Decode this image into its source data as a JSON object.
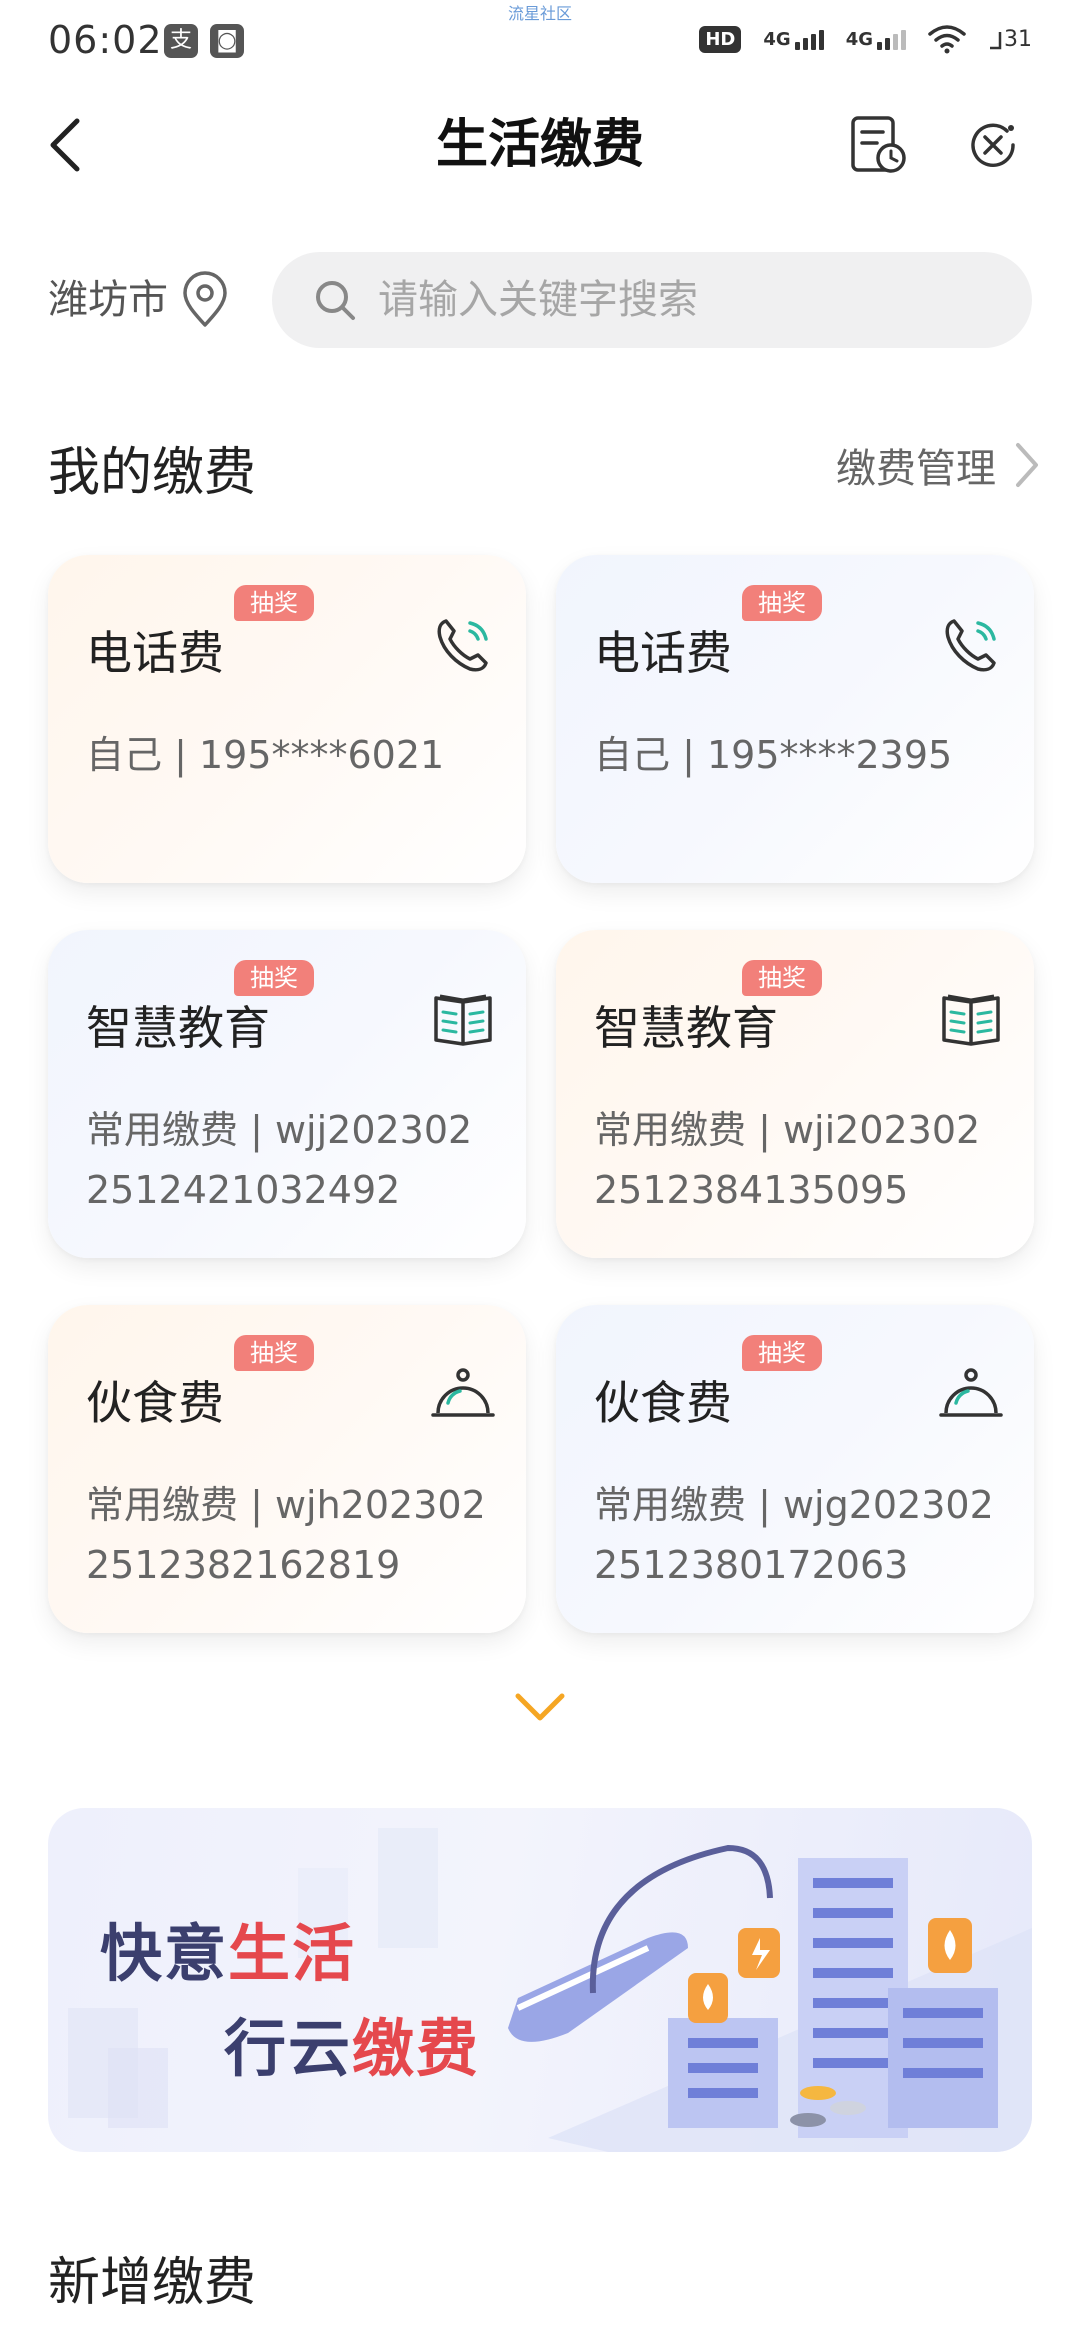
{
  "status_bar": {
    "time": "06:02",
    "app_icons": [
      "支",
      "◙"
    ],
    "watermark": "流星社区",
    "hd_label": "HD",
    "network1": "4G",
    "network2": "4G",
    "battery": "31"
  },
  "header": {
    "title": "生活缴费",
    "back_icon": "chevron-left-icon",
    "record_icon": "bill-record-icon",
    "close_icon": "close-icon"
  },
  "location": {
    "city": "潍坊市"
  },
  "search": {
    "placeholder": "请输入关键字搜索"
  },
  "my_payments": {
    "title": "我的缴费",
    "manage_label": "缴费管理",
    "cards": [
      {
        "badge": "抽奖",
        "title": "电话费",
        "subtitle": "自己 | 195****6021",
        "icon": "phone-icon",
        "theme": "warm"
      },
      {
        "badge": "抽奖",
        "title": "电话费",
        "subtitle": "自己 | 195****2395",
        "icon": "phone-icon",
        "theme": "cool"
      },
      {
        "badge": "抽奖",
        "title": "智慧教育",
        "subtitle": "常用缴费 | wjj2023022512421032492",
        "icon": "book-icon",
        "theme": "cool"
      },
      {
        "badge": "抽奖",
        "title": "智慧教育",
        "subtitle": "常用缴费 | wji2023022512384135095",
        "icon": "book-icon",
        "theme": "warm"
      },
      {
        "badge": "抽奖",
        "title": "伙食费",
        "subtitle": "常用缴费 | wjh2023022512382162819",
        "icon": "food-cloche-icon",
        "theme": "warm"
      },
      {
        "badge": "抽奖",
        "title": "伙食费",
        "subtitle": "常用缴费 | wjg2023022512380172063",
        "icon": "food-cloche-icon",
        "theme": "cool"
      }
    ]
  },
  "banner": {
    "line1_a": "快意",
    "line1_b": "生活",
    "line2_a": "行云",
    "line2_b": "缴费"
  },
  "new_payment": {
    "title": "新增缴费"
  },
  "colors": {
    "accent_orange": "#f5a623",
    "badge_red": "#f2807a",
    "icon_teal": "#2bb8a0",
    "banner_red": "#e5484d",
    "banner_dark": "#3b3f6e"
  }
}
